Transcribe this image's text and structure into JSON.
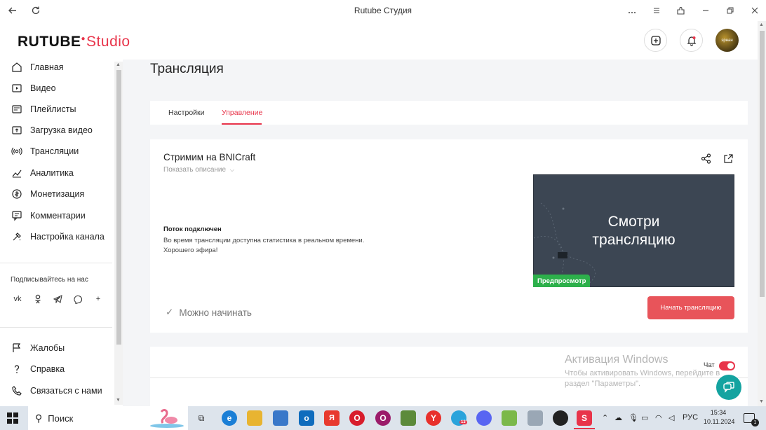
{
  "window": {
    "title": "Rutube Студия"
  },
  "header": {
    "logo_main": "RUTUBE",
    "logo_studio": "Studio",
    "avatar_text": "эрнан"
  },
  "sidebar": {
    "items": [
      {
        "label": "Главная",
        "icon": "home-icon"
      },
      {
        "label": "Видео",
        "icon": "video-icon"
      },
      {
        "label": "Плейлисты",
        "icon": "playlist-icon"
      },
      {
        "label": "Загрузка видео",
        "icon": "upload-icon"
      },
      {
        "label": "Трансляции",
        "icon": "broadcast-icon"
      },
      {
        "label": "Аналитика",
        "icon": "analytics-icon"
      },
      {
        "label": "Монетизация",
        "icon": "monetization-icon"
      },
      {
        "label": "Комментарии",
        "icon": "comments-icon"
      },
      {
        "label": "Настройка канала",
        "icon": "channel-settings-icon"
      }
    ],
    "subscribe_title": "Подписывайтесь на нас",
    "socials": [
      "vk-icon",
      "ok-icon",
      "telegram-icon",
      "viber-icon",
      "more-icon"
    ],
    "footer_items": [
      {
        "label": "Жалобы",
        "icon": "complaints-icon"
      },
      {
        "label": "Справка",
        "icon": "help-icon"
      },
      {
        "label": "Связаться с нами",
        "icon": "contact-icon"
      }
    ]
  },
  "main": {
    "page_title": "Трансляция",
    "tabs": [
      {
        "label": "Настройки"
      },
      {
        "label": "Управление"
      }
    ],
    "stream": {
      "title": "Стримим на BNICraft",
      "show_description": "Показать описание",
      "status_title": "Поток подключен",
      "status_line1": "Во время трансляции доступна статистика в реальном времени.",
      "status_line2": "Хорошего эфира!",
      "preview_line1": "Смотри",
      "preview_line2": "трансляцию",
      "preview_badge": "Предпросмотр",
      "can_start": "Можно начинать",
      "start_button": "Начать трансляцию"
    },
    "chat": {
      "label": "Чат",
      "enabled": true
    }
  },
  "watermark": {
    "line1": "Активация Windows",
    "line2": "Чтобы активировать Windows, перейдите в раздел \"Параметры\"."
  },
  "taskbar": {
    "search_label": "Поиск",
    "lang": "РУС",
    "time": "15:34",
    "date": "10.11.2024",
    "notification_count": "1",
    "telegram_badge": "13"
  },
  "colors": {
    "accent": "#e8344a",
    "preview_badge": "#2db04b",
    "start_button": "#e8545a",
    "help_fab": "#14a3a0"
  }
}
